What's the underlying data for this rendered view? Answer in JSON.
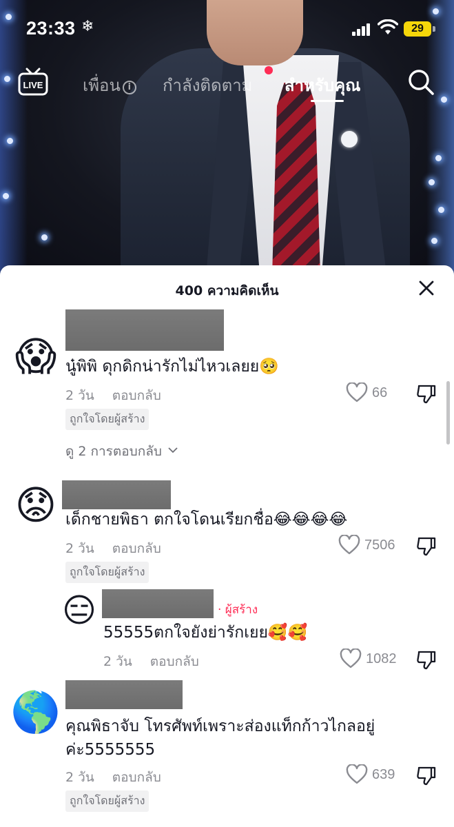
{
  "status_bar": {
    "time": "23:33",
    "time_icon": "snowflake-icon",
    "battery": "29"
  },
  "top_nav": {
    "live_label": "LIVE",
    "tabs": [
      {
        "label": "เพื่อน",
        "state": "inactive"
      },
      {
        "label": "กำลังติดตาม",
        "state": "inactive"
      },
      {
        "label": "สำหรับคุณ",
        "state": "active"
      }
    ]
  },
  "comments_sheet": {
    "title": "400 ความคิดเห็น",
    "comments": [
      {
        "avatar": "😱",
        "text": "นู๋พิพิ ดุกดิกน่ารักไม่ไหวเลยย🥺",
        "time": "2 วัน",
        "reply_label": "ตอบกลับ",
        "likes": "66",
        "liked_by_creator": "ถูกใจโดยผู้สร้าง",
        "view_replies": "ดู 2 การตอบกลับ"
      },
      {
        "avatar": "😟",
        "text": "เด็กชายพิธา ตกใจโดนเรียกชื่อ😂😂😂😂",
        "time": "2 วัน",
        "reply_label": "ตอบกลับ",
        "likes": "7506",
        "liked_by_creator": "ถูกใจโดยผู้สร้าง"
      },
      {
        "avatar": "😑",
        "creator_tag": "· ผู้สร้าง",
        "text": "55555ตกใจยังย่ารักเยย🥰🥰",
        "time": "2 วัน",
        "reply_label": "ตอบกลับ",
        "likes": "1082"
      },
      {
        "avatar": "🌎",
        "text_line1": "คุณพิธาจับ โทรศัพท์เพราะส่องแท็กก้าวไกลอยู่",
        "text_line2": "ค่ะ5555555",
        "time": "2 วัน",
        "reply_label": "ตอบกลับ",
        "likes": "639",
        "liked_by_creator": "ถูกใจโดยผู้สร้าง"
      }
    ]
  },
  "colors": {
    "accent": "#fe2c55",
    "text": "#161823",
    "muted": "#8a8b91",
    "battery": "#f5d60a"
  }
}
